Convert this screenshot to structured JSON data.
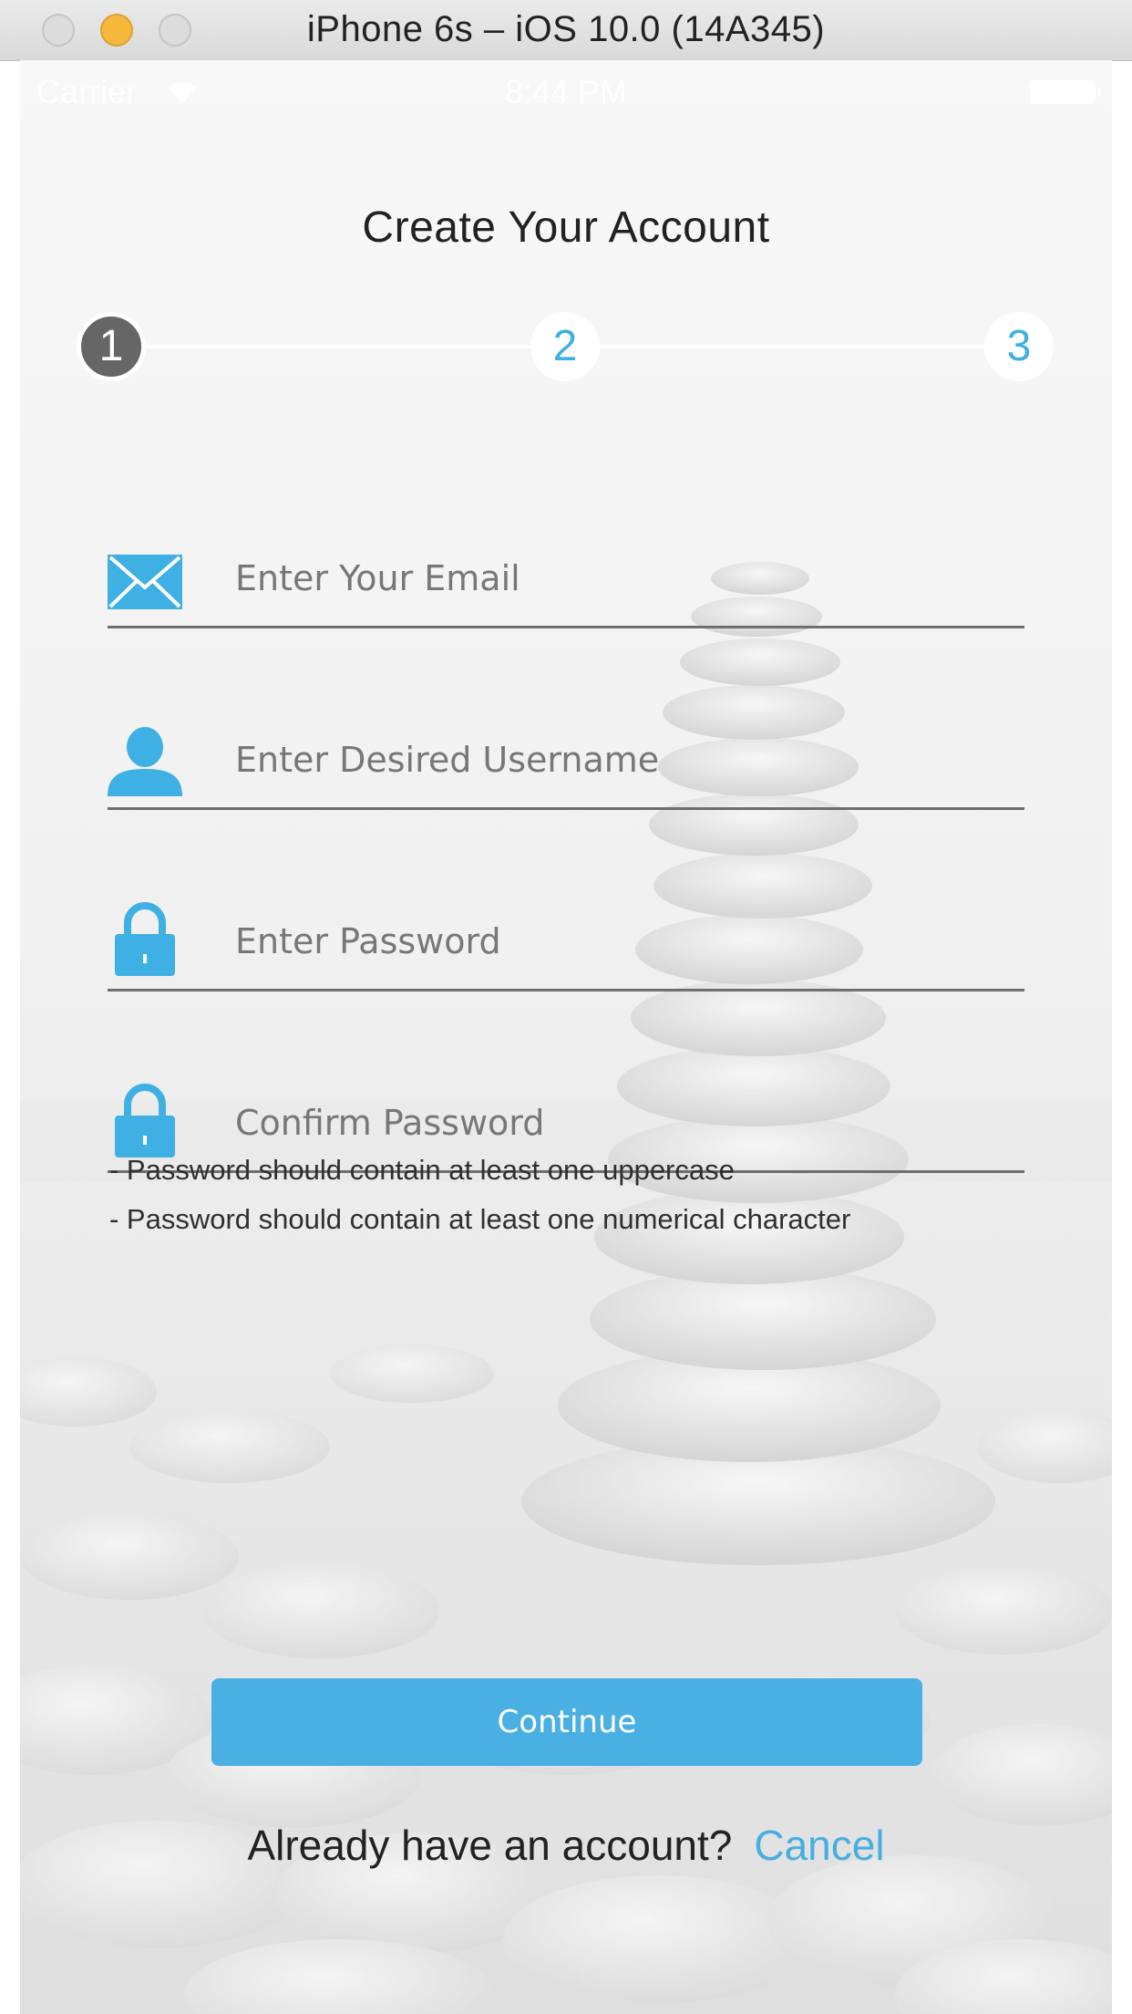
{
  "window": {
    "title": "iPhone 6s – iOS 10.0 (14A345)"
  },
  "status_bar": {
    "carrier": "Carrier",
    "time": "8:44 PM"
  },
  "page": {
    "title": "Create Your Account"
  },
  "stepper": {
    "steps": [
      "1",
      "2",
      "3"
    ],
    "active_step": 1
  },
  "form": {
    "email": {
      "placeholder": "Enter Your Email",
      "value": ""
    },
    "username": {
      "placeholder": "Enter Desired Username",
      "value": ""
    },
    "password": {
      "placeholder": "Enter Password",
      "value": ""
    },
    "confirm_password": {
      "placeholder": "Confirm Password",
      "value": ""
    }
  },
  "hints": [
    "- Password should contain at least one uppercase",
    "- Password should contain at least one numerical character"
  ],
  "actions": {
    "continue_label": "Continue",
    "account_prompt": "Already have an account?",
    "cancel_label": "Cancel"
  },
  "colors": {
    "accent": "#4aafe2",
    "active_step": "#666666",
    "field_underline": "#6e6e6e"
  },
  "icons": {
    "email": "envelope-icon",
    "username": "user-icon",
    "password": "lock-icon",
    "confirm_password": "lock-icon"
  }
}
